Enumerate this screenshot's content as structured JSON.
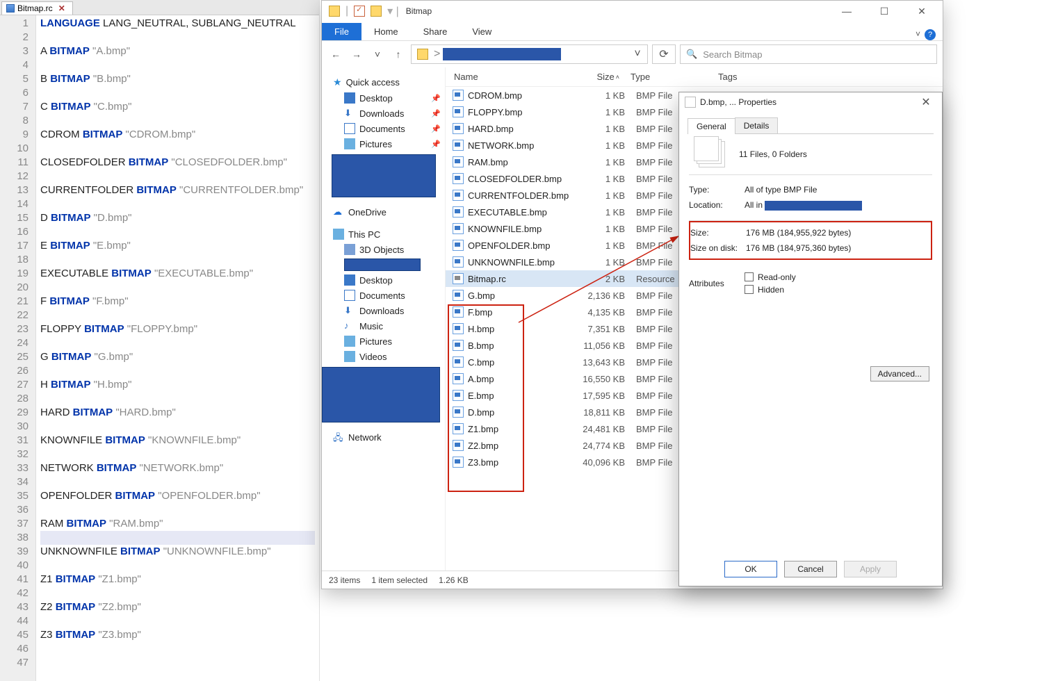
{
  "editor": {
    "tab_name": "Bitmap.rc",
    "lines": [
      {
        "t": "kw-str",
        "a": "LANGUAGE",
        "b": " LANG_NEUTRAL, SUBLANG_NEUTRAL"
      },
      {
        "t": "blank"
      },
      {
        "t": "bmp",
        "id": "A",
        "kw": "BITMAP",
        "s": "\"A.bmp\""
      },
      {
        "t": "blank"
      },
      {
        "t": "bmp",
        "id": "B",
        "kw": "BITMAP",
        "s": "\"B.bmp\""
      },
      {
        "t": "blank"
      },
      {
        "t": "bmp",
        "id": "C",
        "kw": "BITMAP",
        "s": "\"C.bmp\""
      },
      {
        "t": "blank"
      },
      {
        "t": "bmp",
        "id": "CDROM",
        "kw": "BITMAP",
        "s": "\"CDROM.bmp\""
      },
      {
        "t": "blank"
      },
      {
        "t": "bmp",
        "id": "CLOSEDFOLDER",
        "kw": "BITMAP",
        "s": "\"CLOSEDFOLDER.bmp\""
      },
      {
        "t": "blank"
      },
      {
        "t": "bmp",
        "id": "CURRENTFOLDER",
        "kw": "BITMAP",
        "s": "\"CURRENTFOLDER.bmp\""
      },
      {
        "t": "blank"
      },
      {
        "t": "bmp",
        "id": "D",
        "kw": "BITMAP",
        "s": "\"D.bmp\""
      },
      {
        "t": "blank"
      },
      {
        "t": "bmp",
        "id": "E",
        "kw": "BITMAP",
        "s": "\"E.bmp\""
      },
      {
        "t": "blank"
      },
      {
        "t": "bmp",
        "id": "EXECUTABLE",
        "kw": "BITMAP",
        "s": "\"EXECUTABLE.bmp\""
      },
      {
        "t": "blank"
      },
      {
        "t": "bmp",
        "id": "F",
        "kw": "BITMAP",
        "s": "\"F.bmp\""
      },
      {
        "t": "blank"
      },
      {
        "t": "bmp",
        "id": "FLOPPY",
        "kw": "BITMAP",
        "s": "\"FLOPPY.bmp\""
      },
      {
        "t": "blank"
      },
      {
        "t": "bmp",
        "id": "G",
        "kw": "BITMAP",
        "s": "\"G.bmp\""
      },
      {
        "t": "blank"
      },
      {
        "t": "bmp",
        "id": "H",
        "kw": "BITMAP",
        "s": "\"H.bmp\""
      },
      {
        "t": "blank"
      },
      {
        "t": "bmp",
        "id": "HARD",
        "kw": "BITMAP",
        "s": "\"HARD.bmp\""
      },
      {
        "t": "blank"
      },
      {
        "t": "bmp",
        "id": "KNOWNFILE",
        "kw": "BITMAP",
        "s": "\"KNOWNFILE.bmp\""
      },
      {
        "t": "blank"
      },
      {
        "t": "bmp",
        "id": "NETWORK",
        "kw": "BITMAP",
        "s": "\"NETWORK.bmp\""
      },
      {
        "t": "blank"
      },
      {
        "t": "bmp",
        "id": "OPENFOLDER",
        "kw": "BITMAP",
        "s": "\"OPENFOLDER.bmp\""
      },
      {
        "t": "blank"
      },
      {
        "t": "bmp",
        "id": "RAM",
        "kw": "BITMAP",
        "s": "\"RAM.bmp\""
      },
      {
        "t": "blank",
        "hl": true
      },
      {
        "t": "bmp",
        "id": "UNKNOWNFILE",
        "kw": "BITMAP",
        "s": "\"UNKNOWNFILE.bmp\""
      },
      {
        "t": "blank"
      },
      {
        "t": "bmp",
        "id": "Z1",
        "kw": "BITMAP",
        "s": "\"Z1.bmp\""
      },
      {
        "t": "blank"
      },
      {
        "t": "bmp",
        "id": "Z2",
        "kw": "BITMAP",
        "s": "\"Z2.bmp\""
      },
      {
        "t": "blank"
      },
      {
        "t": "bmp",
        "id": "Z3",
        "kw": "BITMAP",
        "s": "\"Z3.bmp\""
      },
      {
        "t": "blank"
      },
      {
        "t": "blank"
      }
    ]
  },
  "explorer": {
    "title": "Bitmap",
    "ribbon": {
      "file": "File",
      "tabs": [
        "Home",
        "Share",
        "View"
      ]
    },
    "search_placeholder": "Search Bitmap",
    "sidebar": {
      "quick": "Quick access",
      "quick_items": [
        "Desktop",
        "Downloads",
        "Documents",
        "Pictures"
      ],
      "onedrive": "OneDrive",
      "thispc": "This PC",
      "thispc_items": [
        "3D Objects",
        "Desktop",
        "Documents",
        "Downloads",
        "Music",
        "Pictures",
        "Videos"
      ],
      "network": "Network"
    },
    "columns": {
      "name": "Name",
      "size": "Size",
      "type": "Type",
      "tags": "Tags"
    },
    "files": [
      {
        "n": "CDROM.bmp",
        "s": "1 KB",
        "t": "BMP File"
      },
      {
        "n": "FLOPPY.bmp",
        "s": "1 KB",
        "t": "BMP File"
      },
      {
        "n": "HARD.bmp",
        "s": "1 KB",
        "t": "BMP File"
      },
      {
        "n": "NETWORK.bmp",
        "s": "1 KB",
        "t": "BMP File"
      },
      {
        "n": "RAM.bmp",
        "s": "1 KB",
        "t": "BMP File"
      },
      {
        "n": "CLOSEDFOLDER.bmp",
        "s": "1 KB",
        "t": "BMP File"
      },
      {
        "n": "CURRENTFOLDER.bmp",
        "s": "1 KB",
        "t": "BMP File"
      },
      {
        "n": "EXECUTABLE.bmp",
        "s": "1 KB",
        "t": "BMP File"
      },
      {
        "n": "KNOWNFILE.bmp",
        "s": "1 KB",
        "t": "BMP File"
      },
      {
        "n": "OPENFOLDER.bmp",
        "s": "1 KB",
        "t": "BMP File"
      },
      {
        "n": "UNKNOWNFILE.bmp",
        "s": "1 KB",
        "t": "BMP File"
      },
      {
        "n": "Bitmap.rc",
        "s": "2 KB",
        "t": "Resource",
        "sel": true,
        "rc": true
      },
      {
        "n": "G.bmp",
        "s": "2,136 KB",
        "t": "BMP File"
      },
      {
        "n": "F.bmp",
        "s": "4,135 KB",
        "t": "BMP File"
      },
      {
        "n": "H.bmp",
        "s": "7,351 KB",
        "t": "BMP File"
      },
      {
        "n": "B.bmp",
        "s": "11,056 KB",
        "t": "BMP File"
      },
      {
        "n": "C.bmp",
        "s": "13,643 KB",
        "t": "BMP File"
      },
      {
        "n": "A.bmp",
        "s": "16,550 KB",
        "t": "BMP File"
      },
      {
        "n": "E.bmp",
        "s": "17,595 KB",
        "t": "BMP File"
      },
      {
        "n": "D.bmp",
        "s": "18,811 KB",
        "t": "BMP File"
      },
      {
        "n": "Z1.bmp",
        "s": "24,481 KB",
        "t": "BMP File"
      },
      {
        "n": "Z2.bmp",
        "s": "24,774 KB",
        "t": "BMP File"
      },
      {
        "n": "Z3.bmp",
        "s": "40,096 KB",
        "t": "BMP File"
      }
    ],
    "status": {
      "count": "23 items",
      "sel": "1 item selected",
      "size": "1.26 KB"
    }
  },
  "props": {
    "title": "D.bmp, ... Properties",
    "tabs": {
      "general": "General",
      "details": "Details"
    },
    "summary": "11 Files, 0 Folders",
    "type_lbl": "Type:",
    "type_val": "All of type BMP File",
    "loc_lbl": "Location:",
    "loc_val": "All in ",
    "size_lbl": "Size:",
    "size_val": "176 MB (184,955,922 bytes)",
    "disk_lbl": "Size on disk:",
    "disk_val": "176 MB (184,975,360 bytes)",
    "attr_lbl": "Attributes",
    "readonly": "Read-only",
    "hidden": "Hidden",
    "advanced": "Advanced...",
    "ok": "OK",
    "cancel": "Cancel",
    "apply": "Apply"
  }
}
